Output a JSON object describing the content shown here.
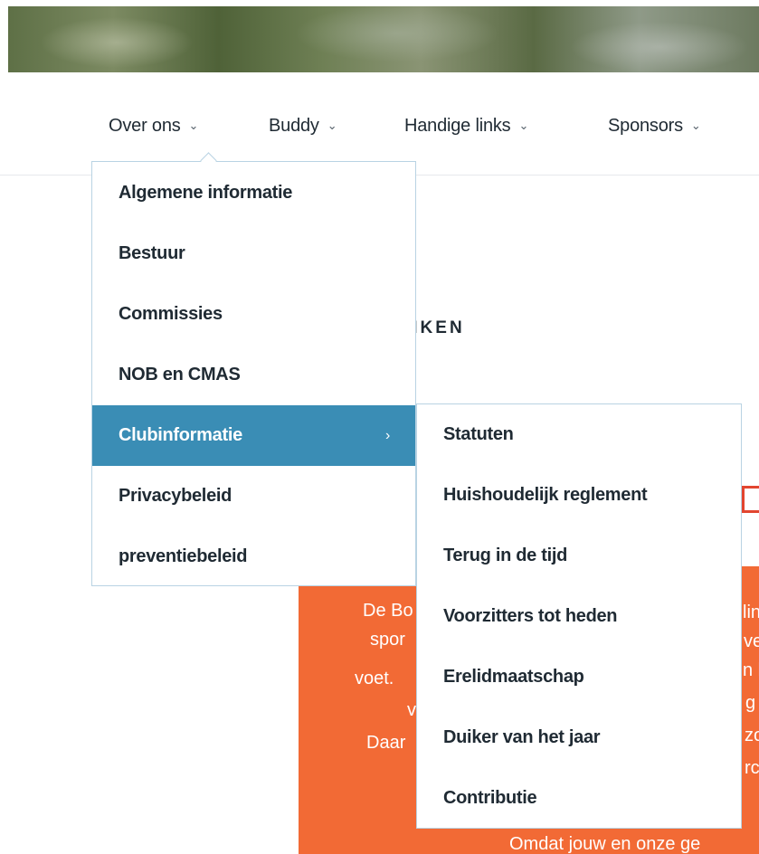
{
  "nav": {
    "items": [
      {
        "label": "Over ons",
        "chevron": "⌄"
      },
      {
        "label": "Buddy",
        "chevron": "⌄"
      },
      {
        "label": "Handige links",
        "chevron": "⌄"
      },
      {
        "label": "Sponsors",
        "chevron": "⌄"
      }
    ]
  },
  "dropdown": {
    "items": [
      {
        "label": "Algemene informatie"
      },
      {
        "label": "Bestuur"
      },
      {
        "label": "Commissies"
      },
      {
        "label": "NOB en CMAS"
      },
      {
        "label": "Clubinformatie",
        "chevron": "›"
      },
      {
        "label": "Privacybeleid"
      },
      {
        "label": "preventiebeleid"
      }
    ],
    "submenu": {
      "items": [
        {
          "label": "Statuten"
        },
        {
          "label": "Huishoudelijk reglement"
        },
        {
          "label": "Terug in de tijd"
        },
        {
          "label": "Voorzitters tot heden"
        },
        {
          "label": "Erelidmaatschap"
        },
        {
          "label": "Duiker van het jaar"
        },
        {
          "label": "Contributie"
        }
      ]
    }
  },
  "background": {
    "heading_fragment": "IIKEN",
    "orange": {
      "left_fragments": [
        "De Bo",
        "spor",
        "voet.",
        "v",
        "Daar"
      ],
      "right_fragments": [
        "lin",
        "ve",
        "n l",
        "g",
        "zo",
        "rc"
      ],
      "bottom_line": "Omdat jouw en onze ge"
    }
  },
  "colors": {
    "active_item_bg": "#3a8db5",
    "menu_border": "#b9d3e3",
    "orange_block": "#f26a35",
    "text_dark": "#1f2a33"
  }
}
